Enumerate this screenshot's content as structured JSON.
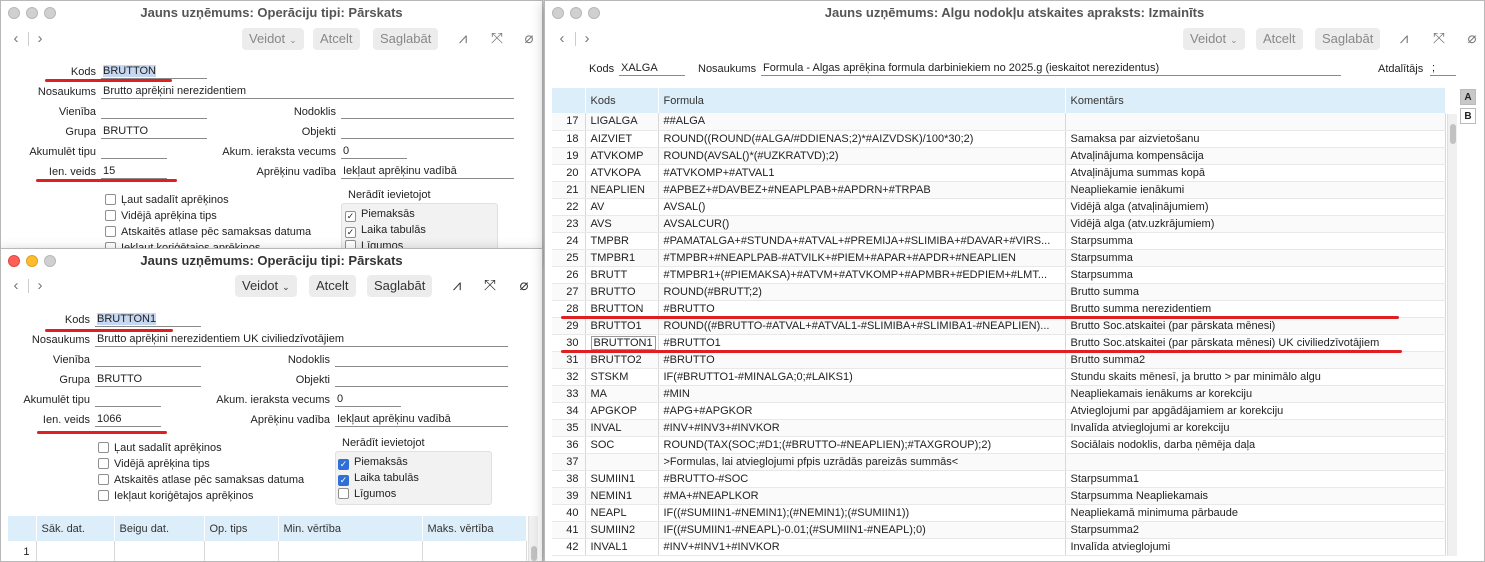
{
  "toolbar": {
    "create": "Veidot",
    "cancel": "Atcelt",
    "save": "Saglabāt"
  },
  "labels": {
    "code": "Kods",
    "name": "Nosaukums",
    "unit": "Vienība",
    "tax": "Nodoklis",
    "group": "Grupa",
    "objects": "Objekti",
    "accumulate": "Akumulēt tipu",
    "accum_age": "Akum. ieraksta vecums",
    "income_type": "Ien. veids",
    "calc_mode": "Aprēķinu vadība",
    "chk_split": "Ļaut sadalīt aprēķinos",
    "chk_avg": "Vidējā aprēķina tips",
    "chk_report": "Atskaitēs atlase pēc samaksas datuma",
    "chk_correct": "Iekļaut koriģētajos aprēķinos",
    "show_title": "Nerādīt ievietojot",
    "show_pay": "Piemaksās",
    "show_time": "Laika tabulās",
    "show_contract": "Līgumos"
  },
  "win_back_left": {
    "title": "Jauns uzņēmums: Operāciju tipi: Pārskats",
    "code": "BRUTTON",
    "name": "Brutto aprēķini nerezidentiem",
    "group": "BRUTTO",
    "accum_age": "0",
    "income_type": "15",
    "calc_mode": "Iekļaut aprēķinu vadībā",
    "show_pay_checked": true,
    "show_time_checked": true,
    "show_contract_checked": false
  },
  "win_front_left": {
    "title": "Jauns uzņēmums: Operāciju tipi: Pārskats",
    "code": "BRUTTON1",
    "name": "Brutto aprēķini nerezidentiem UK civiliedzīvotājiem",
    "group": "BRUTTO",
    "accum_age": "0",
    "income_type": "1066",
    "calc_mode": "Iekļaut aprēķinu vadībā",
    "show_pay_checked": true,
    "show_time_checked": true,
    "show_contract_checked": false,
    "table": {
      "headers": [
        "Sāk. dat.",
        "Beigu dat.",
        "Op. tips",
        "Min. vērtība",
        "Maks. vērtība"
      ],
      "first_row": "1"
    }
  },
  "win_right": {
    "title": "Jauns uzņēmums: Algu nodokļu atskaites apraksts: Izmainīts",
    "code_label": "Kods",
    "code": "XALGA",
    "name_label": "Nosaukums",
    "name": "Formula - Algas aprēķina formula darbiniekiem no 2025.g (ieskaitot nerezidentus)",
    "sep_label": "Atdalītājs",
    "sep": ";",
    "headers": [
      "",
      "Kods",
      "Formula",
      "Komentārs"
    ],
    "side_a": "A",
    "side_b": "B",
    "rows": [
      [
        "17",
        "LIGALGA",
        "##ALGA",
        ""
      ],
      [
        "18",
        "AIZVIET",
        "ROUND((ROUND(#ALGA/#DDIENAS;2)*#AIZVDSK)/100*30;2)",
        "Samaksa par aizvietošanu"
      ],
      [
        "19",
        "ATVKOMP",
        "ROUND(AVSAL()*(#UZKRATVD);2)",
        "Atvaļinājuma kompensācija"
      ],
      [
        "20",
        "ATVKOPA",
        "#ATVKOMP+#ATVAL1",
        "Atvaļinājuma summas kopā"
      ],
      [
        "21",
        "NEAPLIEN",
        "#APBEZ+#DAVBEZ+#NEAPLPAB+#APDRN+#TRPAB",
        "Neapliekamie ienākumi"
      ],
      [
        "22",
        "AV",
        "AVSAL()",
        "Vidējā alga (atvaļinājumiem)"
      ],
      [
        "23",
        "AVS",
        "AVSALCUR()",
        "Vidējā alga (atv.uzkrājumiem)"
      ],
      [
        "24",
        "TMPBR",
        "#PAMATALGA+#STUNDA+#ATVAL+#PREMIJA+#SLIMIBA+#DAVAR+#VIRS...",
        "Starpsumma"
      ],
      [
        "25",
        "TMPBR1",
        "#TMPBR+#NEAPLPAB-#ATVILK+#PIEM+#APAR+#APDR+#NEAPLIEN",
        "Starpsumma"
      ],
      [
        "26",
        "BRUTT",
        "#TMPBR1+(#PIEMAKSA)+#ATVM+#ATVKOMP+#APMBR+#EDPIEM+#LMT...",
        "Starpsumma"
      ],
      [
        "27",
        "BRUTTO",
        "ROUND(#BRUTT;2)",
        "Brutto summa"
      ],
      [
        "28",
        "BRUTTON",
        "#BRUTTO",
        "Brutto summa nerezidentiem"
      ],
      [
        "29",
        "BRUTTO1",
        "ROUND((#BRUTTO-#ATVAL+#ATVAL1-#SLIMIBA+#SLIMIBA1-#NEAPLIEN)...",
        "Brutto Soc.atskaitei (par pārskata mēnesi)"
      ],
      [
        "30",
        "BRUTTON1",
        "#BRUTTO1",
        "Brutto Soc.atskaitei (par pārskata mēnesi) UK civiliedzīvotājiem"
      ],
      [
        "31",
        "BRUTTO2",
        "#BRUTTO",
        "Brutto summa2"
      ],
      [
        "32",
        "STSKM",
        "IF(#BRUTTO1-#MINALGA;0;#LAIKS1)",
        "Stundu skaits mēnesī, ja brutto > par minimālo algu"
      ],
      [
        "33",
        "MA",
        "#MIN",
        "Neapliekamais ienākums ar korekciju"
      ],
      [
        "34",
        "APGKOP",
        "#APG+#APGKOR",
        "Atvieglojumi par apgādājamiem ar korekciju"
      ],
      [
        "35",
        "INVAL",
        "#INV+#INV3+#INVKOR",
        "Invalīda atvieglojumi ar korekciju"
      ],
      [
        "36",
        "SOC",
        "ROUND(TAX(SOC;#D1;(#BRUTTO-#NEAPLIEN);#TAXGROUP);2)",
        "Sociālais nodoklis, darba ņēmēja daļa"
      ],
      [
        "37",
        "",
        ">Formulas, lai atvieglojumi pfpis uzrādās pareizās summās<",
        ""
      ],
      [
        "38",
        "SUMIIN1",
        "#BRUTTO-#SOC",
        "Starpsumma1"
      ],
      [
        "39",
        "NEMIN1",
        "#MA+#NEAPLKOR",
        "Starpsumma Neapliekamais"
      ],
      [
        "40",
        "NEAPL",
        "IF((#SUMIIN1-#NEMIN1);(#NEMIN1);(#SUMIIN1))",
        "Neapliekamā minimuma pārbaude"
      ],
      [
        "41",
        "SUMIIN2",
        "IF((#SUMIIN1-#NEAPL)-0.01;(#SUMIIN1-#NEAPL);0)",
        "Starpsumma2"
      ],
      [
        "42",
        "INVAL1",
        "#INV+#INV1+#INVKOR",
        "Invalīda atvieglojumi"
      ]
    ]
  },
  "colors": {
    "accent": "#2f6fd6",
    "annotation": "#e02020",
    "header_bg": "#dceefa"
  }
}
